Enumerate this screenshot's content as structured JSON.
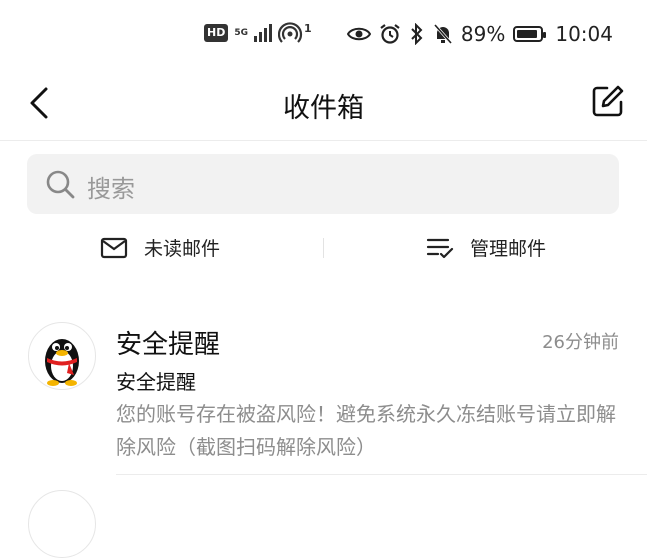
{
  "status_bar": {
    "hd": "HD",
    "network": "5G",
    "hotspot_count": "1",
    "battery": "89%",
    "battery_level": 0.89,
    "time": "10:04"
  },
  "header": {
    "title": "收件箱"
  },
  "search": {
    "placeholder": "搜索"
  },
  "toolbar": {
    "unread_label": "未读邮件",
    "manage_label": "管理邮件"
  },
  "mails": [
    {
      "sender": "安全提醒",
      "time": "26分钟前",
      "subject": "安全提醒",
      "preview": "您的账号存在被盗风险！避免系统永久冻结账号请立即解除风险（截图扫码解除风险）"
    }
  ],
  "icons": {
    "back": "chevron-left-icon",
    "compose": "compose-icon",
    "search": "search-icon",
    "unread": "envelope-icon",
    "manage": "checklist-icon",
    "avatar": "penguin-avatar"
  }
}
